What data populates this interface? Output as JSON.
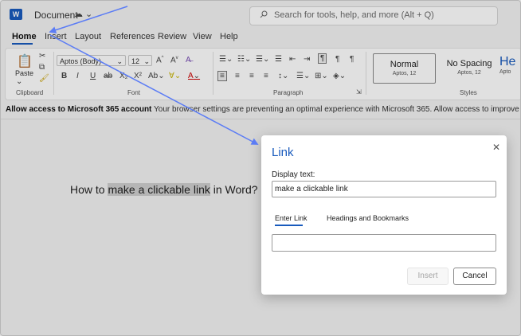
{
  "app": {
    "logo": "W",
    "title": "Document"
  },
  "search": {
    "placeholder": "Search for tools, help, and more (Alt + Q)"
  },
  "tabs": [
    {
      "label": "Home",
      "active": true
    },
    {
      "label": "Insert"
    },
    {
      "label": "Layout"
    },
    {
      "label": "References"
    },
    {
      "label": "Review"
    },
    {
      "label": "View"
    },
    {
      "label": "Help"
    }
  ],
  "ribbon": {
    "clipboard": {
      "label": "Clipboard",
      "paste_label": "Paste"
    },
    "font": {
      "label": "Font",
      "font_name": "Aptos (Body)",
      "font_size": "12"
    },
    "paragraph": {
      "label": "Paragraph"
    },
    "styles": {
      "label": "Styles",
      "items": [
        {
          "name": "Normal",
          "sub": "Aptos, 12"
        },
        {
          "name": "No Spacing",
          "sub": "Aptos, 12"
        },
        {
          "name": "He",
          "sub": "Apto"
        }
      ]
    }
  },
  "infobar": {
    "bold": "Allow access to Microsoft 365 account",
    "text": "Your browser settings are preventing an optimal experience with Microsoft 365. Allow access to improve your experience"
  },
  "document": {
    "before": "How to ",
    "selected": "make a clickable link",
    "after": " in Word?"
  },
  "dialog": {
    "title": "Link",
    "display_label": "Display text:",
    "display_value": "make a clickable link",
    "tab_enter": "Enter Link",
    "tab_headings": "Headings and Bookmarks",
    "insert_label": "Insert",
    "cancel_label": "Cancel"
  },
  "colors": {
    "accent": "#185abd",
    "arrow": "#5b7cf5"
  }
}
